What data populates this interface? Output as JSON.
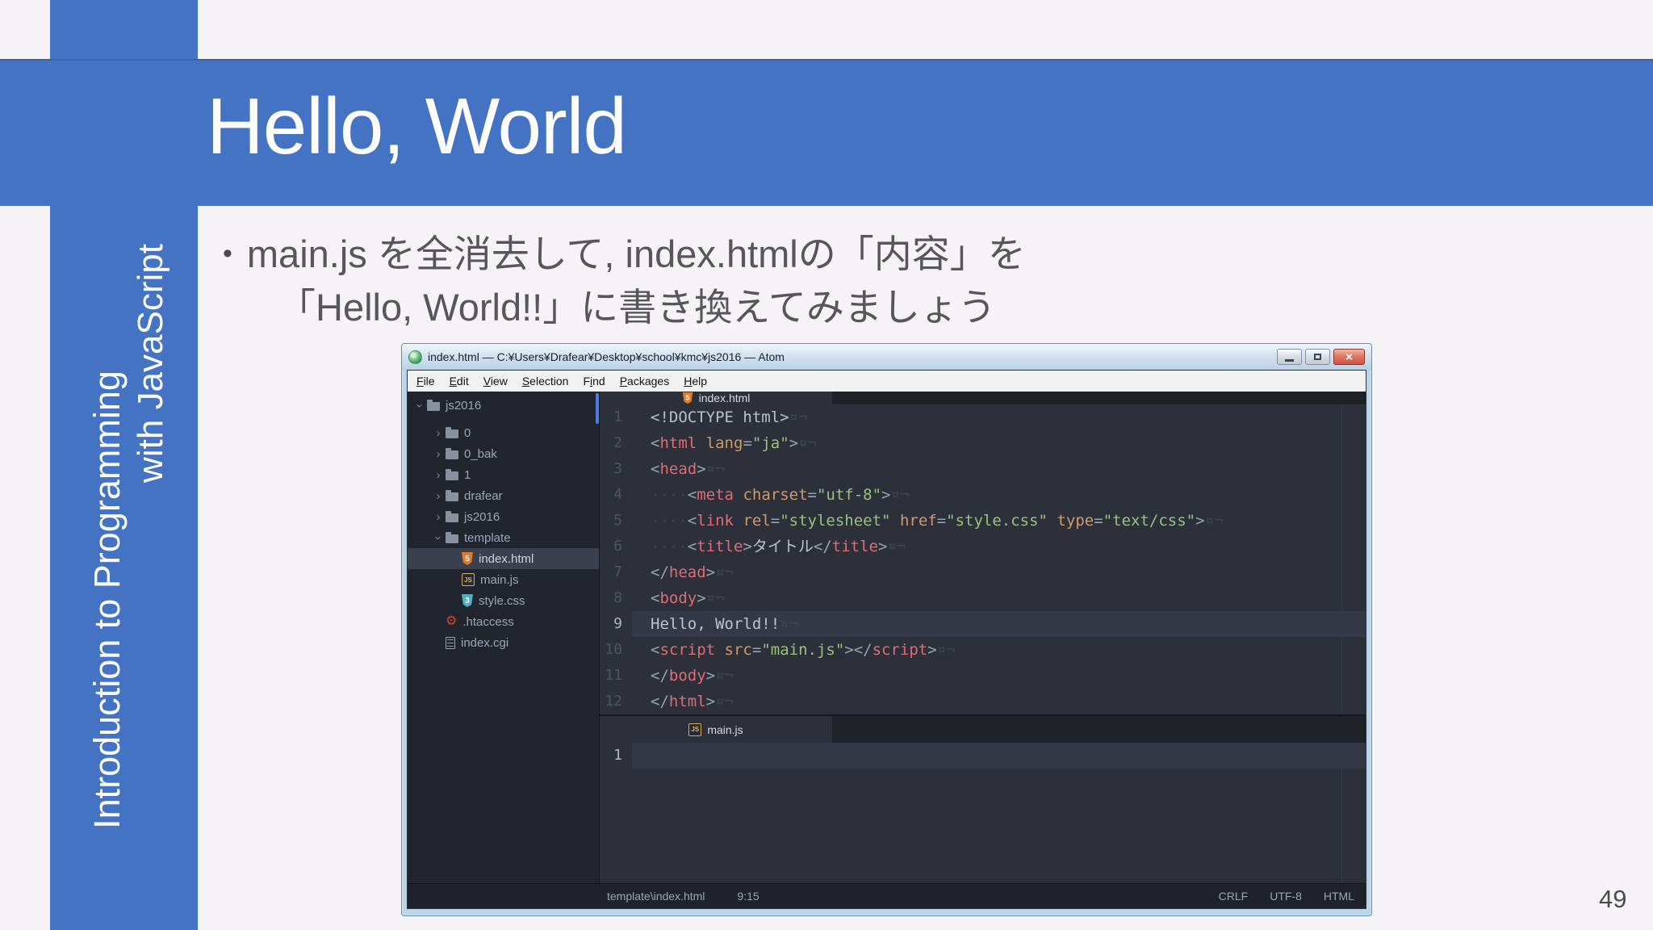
{
  "slide": {
    "title": "Hello, World",
    "sidebar_line1": "Introduction to Programming",
    "sidebar_line2": "with JavaScript",
    "bullet_char": "•",
    "bullet_line1": "main.js を全消去して, index.htmlの「内容」を",
    "bullet_line2": "「Hello, World!!」に書き換えてみましょう",
    "page_number": "49",
    "colors": {
      "accent_blue": "#4573c4",
      "background": "#f6f3f7",
      "body_text": "#57575a"
    }
  },
  "atom": {
    "title_bar": {
      "title": "index.html — C:¥Users¥Drafear¥Desktop¥school¥kmc¥js2016 — Atom",
      "buttons": [
        "minimize",
        "maximize",
        "close"
      ]
    },
    "menu_bar": [
      {
        "pre": "",
        "u": "F",
        "post": "ile"
      },
      {
        "pre": "",
        "u": "E",
        "post": "dit"
      },
      {
        "pre": "",
        "u": "V",
        "post": "iew"
      },
      {
        "pre": "",
        "u": "S",
        "post": "election"
      },
      {
        "pre": "F",
        "u": "i",
        "post": "nd"
      },
      {
        "pre": "",
        "u": "P",
        "post": "ackages"
      },
      {
        "pre": "",
        "u": "H",
        "post": "elp"
      }
    ],
    "tree": [
      {
        "label": "js2016",
        "icon": "folder-icon",
        "indent": "ind0",
        "chevron": "open",
        "root": true
      },
      {
        "label": "0",
        "icon": "folder-icon",
        "indent": "ind1",
        "chevron": "closed"
      },
      {
        "label": "0_bak",
        "icon": "folder-icon",
        "indent": "ind1",
        "chevron": "closed"
      },
      {
        "label": "1",
        "icon": "folder-icon",
        "indent": "ind1",
        "chevron": "closed"
      },
      {
        "label": "drafear",
        "icon": "folder-icon",
        "indent": "ind1",
        "chevron": "closed"
      },
      {
        "label": "js2016",
        "icon": "folder-icon",
        "indent": "ind1",
        "chevron": "closed"
      },
      {
        "label": "template",
        "icon": "folder-icon",
        "indent": "ind1",
        "chevron": "open"
      },
      {
        "label": "index.html",
        "icon": "html-file-icon",
        "indent": "ind2",
        "selected": true
      },
      {
        "label": "main.js",
        "icon": "js-file-icon",
        "indent": "ind2"
      },
      {
        "label": "style.css",
        "icon": "css-file-icon",
        "indent": "ind2"
      },
      {
        "label": ".htaccess",
        "icon": "gear-icon",
        "indent": "ind1f"
      },
      {
        "label": "index.cgi",
        "icon": "file-icon",
        "indent": "ind1f"
      }
    ],
    "panes": [
      {
        "tab": {
          "label": "index.html",
          "icon": "html-file-icon"
        },
        "cursor_line": 9,
        "lines": [
          {
            "num": 1,
            "tokens": [
              [
                "pln",
                "<!DOCTYPE html>"
              ],
              [
                "inv",
                "¤¬"
              ]
            ]
          },
          {
            "num": 2,
            "tokens": [
              [
                "pun",
                "<"
              ],
              [
                "tag",
                "html"
              ],
              [
                "pln",
                " "
              ],
              [
                "attr",
                "lang"
              ],
              [
                "pun",
                "="
              ],
              [
                "str",
                "\"ja\""
              ],
              [
                "pun",
                ">"
              ],
              [
                "inv",
                "¤¬"
              ]
            ]
          },
          {
            "num": 3,
            "tokens": [
              [
                "pun",
                "<"
              ],
              [
                "tag",
                "head"
              ],
              [
                "pun",
                ">"
              ],
              [
                "inv",
                "¤¬"
              ]
            ]
          },
          {
            "num": 4,
            "tokens": [
              [
                "dot",
                "····"
              ],
              [
                "pun",
                "<"
              ],
              [
                "tag",
                "meta"
              ],
              [
                "pln",
                " "
              ],
              [
                "attr",
                "charset"
              ],
              [
                "pun",
                "="
              ],
              [
                "str",
                "\"utf-8\""
              ],
              [
                "pun",
                ">"
              ],
              [
                "inv",
                "¤¬"
              ]
            ]
          },
          {
            "num": 5,
            "tokens": [
              [
                "dot",
                "····"
              ],
              [
                "pun",
                "<"
              ],
              [
                "tag",
                "link"
              ],
              [
                "pln",
                " "
              ],
              [
                "attr",
                "rel"
              ],
              [
                "pun",
                "="
              ],
              [
                "str",
                "\"stylesheet\""
              ],
              [
                "pln",
                " "
              ],
              [
                "attr",
                "href"
              ],
              [
                "pun",
                "="
              ],
              [
                "str",
                "\"style.css\""
              ],
              [
                "pln",
                " "
              ],
              [
                "attr",
                "type"
              ],
              [
                "pun",
                "="
              ],
              [
                "str",
                "\"text/css\""
              ],
              [
                "pun",
                ">"
              ],
              [
                "inv",
                "¤¬"
              ]
            ]
          },
          {
            "num": 6,
            "tokens": [
              [
                "dot",
                "····"
              ],
              [
                "pun",
                "<"
              ],
              [
                "tag",
                "title"
              ],
              [
                "pun",
                ">"
              ],
              [
                "txt",
                "タイトル"
              ],
              [
                "pun",
                "</"
              ],
              [
                "tag",
                "title"
              ],
              [
                "pun",
                ">"
              ],
              [
                "inv",
                "¤¬"
              ]
            ]
          },
          {
            "num": 7,
            "tokens": [
              [
                "pun",
                "</"
              ],
              [
                "tag",
                "head"
              ],
              [
                "pun",
                ">"
              ],
              [
                "inv",
                "¤¬"
              ]
            ]
          },
          {
            "num": 8,
            "tokens": [
              [
                "pun",
                "<"
              ],
              [
                "tag",
                "body"
              ],
              [
                "pun",
                ">"
              ],
              [
                "inv",
                "¤¬"
              ]
            ]
          },
          {
            "num": 9,
            "tokens": [
              [
                "txt",
                "Hello, World!!"
              ],
              [
                "inv",
                "¤¬"
              ]
            ]
          },
          {
            "num": 10,
            "tokens": [
              [
                "pun",
                "<"
              ],
              [
                "tag",
                "script"
              ],
              [
                "pln",
                " "
              ],
              [
                "attr",
                "src"
              ],
              [
                "pun",
                "="
              ],
              [
                "str",
                "\"main.js\""
              ],
              [
                "pun",
                "></"
              ],
              [
                "tag",
                "script"
              ],
              [
                "pun",
                ">"
              ],
              [
                "inv",
                "¤¬"
              ]
            ]
          },
          {
            "num": 11,
            "tokens": [
              [
                "pun",
                "</"
              ],
              [
                "tag",
                "body"
              ],
              [
                "pun",
                ">"
              ],
              [
                "inv",
                "¤¬"
              ]
            ]
          },
          {
            "num": 12,
            "tokens": [
              [
                "pun",
                "</"
              ],
              [
                "tag",
                "html"
              ],
              [
                "pun",
                ">"
              ],
              [
                "inv",
                "¤¬"
              ]
            ]
          }
        ]
      },
      {
        "tab": {
          "label": "main.js",
          "icon": "js-file-icon"
        },
        "cursor_line": 1,
        "lines": [
          {
            "num": 1,
            "tokens": []
          }
        ]
      }
    ],
    "status_bar": {
      "file": "template\\index.html",
      "cursor": "9:15",
      "right": [
        "CRLF",
        "UTF-8",
        "HTML"
      ]
    }
  }
}
